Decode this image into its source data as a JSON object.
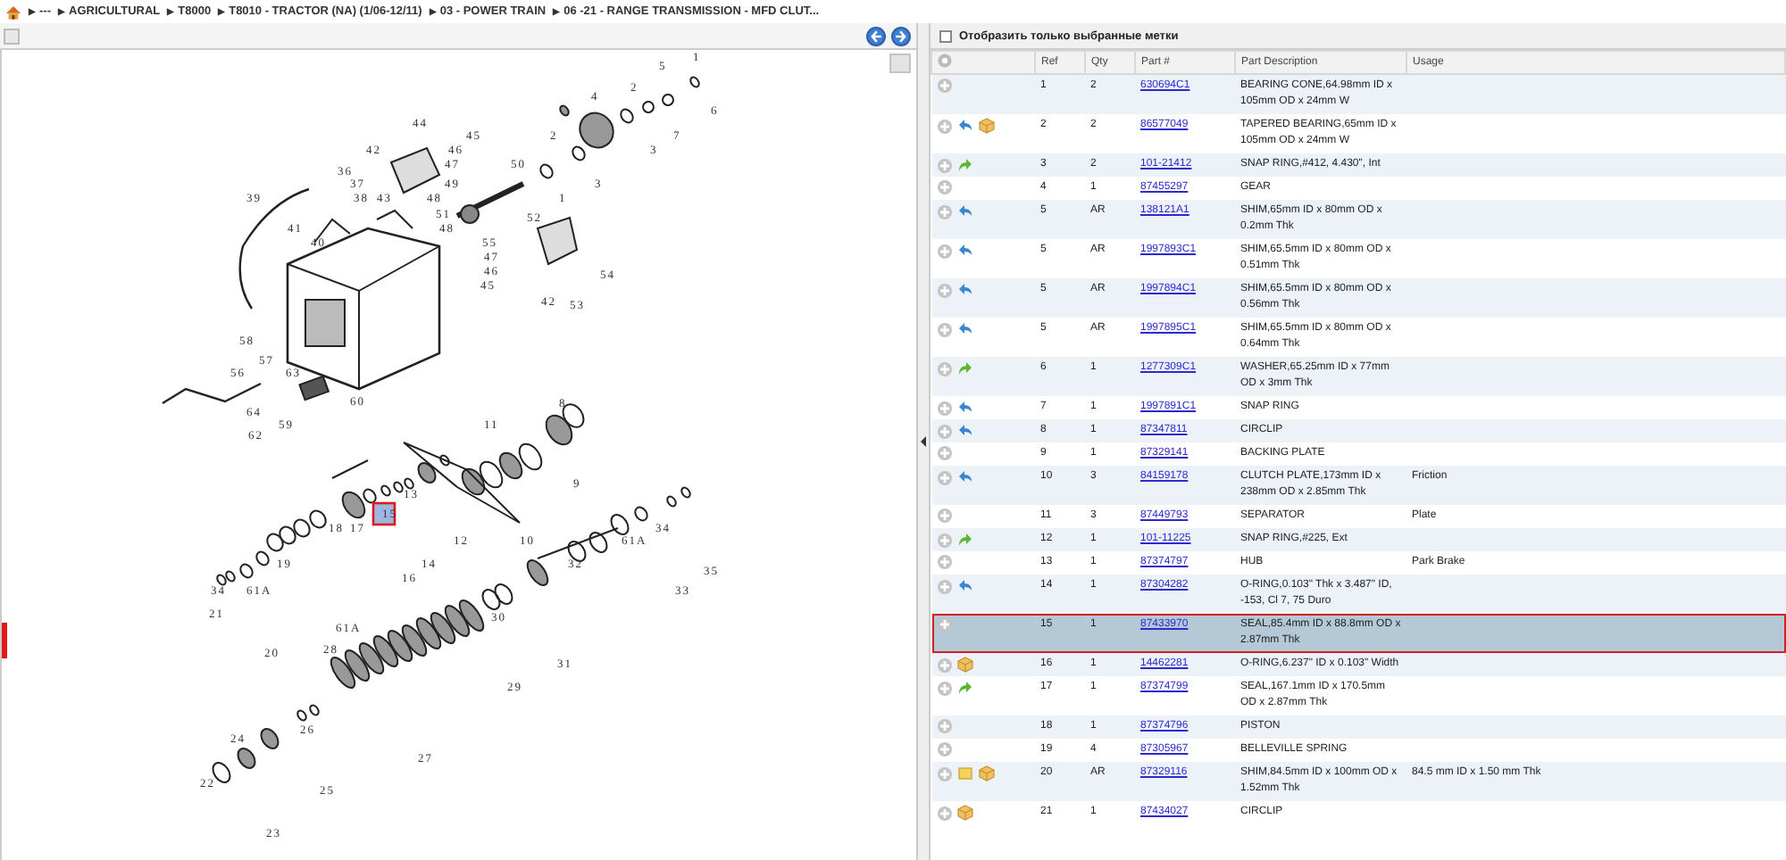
{
  "breadcrumb": {
    "separator": "▶",
    "items": [
      "---",
      "AGRICULTURAL",
      "T8000",
      "T8010 - TRACTOR (NA) (1/06-12/11)",
      "03 - POWER TRAIN",
      "06 -21 - RANGE TRANSMISSION - MFD CLUT..."
    ]
  },
  "diagram": {
    "callouts": [
      {
        "label": "1",
        "selected": false
      },
      {
        "label": "5",
        "selected": false
      },
      {
        "label": "2",
        "selected": false
      },
      {
        "label": "4",
        "selected": false
      },
      {
        "label": "6",
        "selected": false
      },
      {
        "label": "44",
        "selected": false
      },
      {
        "label": "45",
        "selected": false
      },
      {
        "label": "2",
        "selected": false
      },
      {
        "label": "7",
        "selected": false
      },
      {
        "label": "42",
        "selected": false
      },
      {
        "label": "46",
        "selected": false
      },
      {
        "label": "3",
        "selected": false
      },
      {
        "label": "47",
        "selected": false
      },
      {
        "label": "50",
        "selected": false
      },
      {
        "label": "36",
        "selected": false
      },
      {
        "label": "37",
        "selected": false
      },
      {
        "label": "49",
        "selected": false
      },
      {
        "label": "3",
        "selected": false
      },
      {
        "label": "39",
        "selected": false
      },
      {
        "label": "38",
        "selected": false
      },
      {
        "label": "43",
        "selected": false
      },
      {
        "label": "48",
        "selected": false
      },
      {
        "label": "1",
        "selected": false
      },
      {
        "label": "51",
        "selected": false
      },
      {
        "label": "52",
        "selected": false
      },
      {
        "label": "41",
        "selected": false
      },
      {
        "label": "48",
        "selected": false
      },
      {
        "label": "40",
        "selected": false
      },
      {
        "label": "55",
        "selected": false
      },
      {
        "label": "47",
        "selected": false
      },
      {
        "label": "46",
        "selected": false
      },
      {
        "label": "54",
        "selected": false
      },
      {
        "label": "45",
        "selected": false
      },
      {
        "label": "42",
        "selected": false
      },
      {
        "label": "53",
        "selected": false
      },
      {
        "label": "58",
        "selected": false
      },
      {
        "label": "57",
        "selected": false
      },
      {
        "label": "56",
        "selected": false
      },
      {
        "label": "63",
        "selected": false
      },
      {
        "label": "60",
        "selected": false
      },
      {
        "label": "8",
        "selected": false
      },
      {
        "label": "64",
        "selected": false
      },
      {
        "label": "59",
        "selected": false
      },
      {
        "label": "11",
        "selected": false
      },
      {
        "label": "62",
        "selected": false
      },
      {
        "label": "9",
        "selected": false
      },
      {
        "label": "13",
        "selected": false
      },
      {
        "label": "15",
        "selected": true
      },
      {
        "label": "18",
        "selected": false
      },
      {
        "label": "17",
        "selected": false
      },
      {
        "label": "34",
        "selected": false
      },
      {
        "label": "12",
        "selected": false
      },
      {
        "label": "10",
        "selected": false
      },
      {
        "label": "61A",
        "selected": false
      },
      {
        "label": "19",
        "selected": false
      },
      {
        "label": "14",
        "selected": false
      },
      {
        "label": "32",
        "selected": false
      },
      {
        "label": "35",
        "selected": false
      },
      {
        "label": "16",
        "selected": false
      },
      {
        "label": "34",
        "selected": false
      },
      {
        "label": "61A",
        "selected": false
      },
      {
        "label": "33",
        "selected": false
      },
      {
        "label": "21",
        "selected": false
      },
      {
        "label": "30",
        "selected": false
      },
      {
        "label": "61A",
        "selected": false
      },
      {
        "label": "20",
        "selected": false
      },
      {
        "label": "31",
        "selected": false
      },
      {
        "label": "28",
        "selected": false
      },
      {
        "label": "29",
        "selected": false
      },
      {
        "label": "26",
        "selected": false
      },
      {
        "label": "24",
        "selected": false
      },
      {
        "label": "27",
        "selected": false
      },
      {
        "label": "22",
        "selected": false
      },
      {
        "label": "25",
        "selected": false
      },
      {
        "label": "23",
        "selected": false
      }
    ]
  },
  "filter": {
    "label": "Отобразить только выбранные метки",
    "checked": false
  },
  "table": {
    "columns": [
      "Ref",
      "Qty",
      "Part #",
      "Part Description",
      "Usage"
    ],
    "rows": [
      {
        "icons": [],
        "ref": "1",
        "qty": "2",
        "part": "630694C1",
        "description": "BEARING CONE,64.98mm ID x 105mm OD x 24mm W",
        "selected": false
      },
      {
        "icons": [
          {
            "kind": "reverse"
          },
          {
            "kind": "box"
          }
        ],
        "ref": "2",
        "qty": "2",
        "part": "86577049",
        "description": "TAPERED BEARING,65mm ID x 105mm OD x 24mm W",
        "selected": false
      },
      {
        "icons": [
          {
            "kind": "forward"
          }
        ],
        "ref": "3",
        "qty": "2",
        "part": "101-21412",
        "description": "SNAP RING,#412, 4.430\", Int",
        "selected": false
      },
      {
        "icons": [],
        "ref": "4",
        "qty": "1",
        "part": "87455297",
        "description": "GEAR",
        "selected": false
      },
      {
        "icons": [
          {
            "kind": "reverse"
          }
        ],
        "ref": "5",
        "qty": "AR",
        "part": "138121A1",
        "description": "SHIM,65mm ID x 80mm OD x 0.2mm Thk",
        "selected": false
      },
      {
        "icons": [
          {
            "kind": "reverse"
          }
        ],
        "ref": "5",
        "qty": "AR",
        "part": "1997893C1",
        "description": "SHIM,65.5mm ID x 80mm OD x 0.51mm Thk",
        "selected": false
      },
      {
        "icons": [
          {
            "kind": "reverse"
          }
        ],
        "ref": "5",
        "qty": "AR",
        "part": "1997894C1",
        "description": "SHIM,65.5mm ID x 80mm OD x 0.56mm Thk",
        "selected": false
      },
      {
        "icons": [
          {
            "kind": "reverse"
          }
        ],
        "ref": "5",
        "qty": "AR",
        "part": "1997895C1",
        "description": "SHIM,65.5mm ID x 80mm OD x 0.64mm Thk",
        "selected": false
      },
      {
        "icons": [
          {
            "kind": "forward"
          }
        ],
        "ref": "6",
        "qty": "1",
        "part": "1277309C1",
        "description": "WASHER,65.25mm ID x 77mm OD x 3mm Thk",
        "selected": false
      },
      {
        "icons": [
          {
            "kind": "reverse"
          }
        ],
        "ref": "7",
        "qty": "1",
        "part": "1997891C1",
        "description": "SNAP RING",
        "selected": false
      },
      {
        "icons": [
          {
            "kind": "reverse"
          }
        ],
        "ref": "8",
        "qty": "1",
        "part": "87347811",
        "description": "CIRCLIP",
        "selected": false
      },
      {
        "icons": [],
        "ref": "9",
        "qty": "1",
        "part": "87329141",
        "description": "BACKING PLATE",
        "selected": false
      },
      {
        "icons": [
          {
            "kind": "reverse"
          }
        ],
        "ref": "10",
        "qty": "3",
        "part": "84159178",
        "description": "CLUTCH PLATE,173mm ID x 238mm OD x 2.85mm Thk",
        "usage": "Friction",
        "selected": false
      },
      {
        "icons": [],
        "ref": "11",
        "qty": "3",
        "part": "87449793",
        "description": "SEPARATOR",
        "usage": "Plate",
        "selected": false
      },
      {
        "icons": [
          {
            "kind": "forward"
          }
        ],
        "ref": "12",
        "qty": "1",
        "part": "101-11225",
        "description": "SNAP RING,#225, Ext",
        "selected": false
      },
      {
        "icons": [],
        "ref": "13",
        "qty": "1",
        "part": "87374797",
        "description": "HUB",
        "usage": "Park Brake",
        "selected": false
      },
      {
        "icons": [
          {
            "kind": "reverse"
          }
        ],
        "ref": "14",
        "qty": "1",
        "part": "87304282",
        "description": "O-RING,0.103\" Thk x 3.487\" ID, -153, Cl 7, 75 Duro",
        "selected": false
      },
      {
        "icons": [],
        "ref": "15",
        "qty": "1",
        "part": "87433970",
        "description": "SEAL,85.4mm ID x 88.8mm OD x 2.87mm Thk",
        "selected": true
      },
      {
        "icons": [
          {
            "kind": "box"
          }
        ],
        "ref": "16",
        "qty": "1",
        "part": "14462281",
        "description": "O-RING,6.237\" ID x 0.103\" Width",
        "selected": false
      },
      {
        "icons": [
          {
            "kind": "forward"
          }
        ],
        "ref": "17",
        "qty": "1",
        "part": "87374799",
        "description": "SEAL,167.1mm ID x 170.5mm OD x 2.87mm Thk",
        "selected": false
      },
      {
        "icons": [],
        "ref": "18",
        "qty": "1",
        "part": "87374796",
        "description": "PISTON",
        "selected": false
      },
      {
        "icons": [],
        "ref": "19",
        "qty": "4",
        "part": "87305967",
        "description": "BELLEVILLE SPRING",
        "selected": false
      },
      {
        "icons": [
          {
            "kind": "note"
          },
          {
            "kind": "box"
          }
        ],
        "ref": "20",
        "qty": "AR",
        "part": "87329116",
        "description": "SHIM,84.5mm ID x 100mm OD x 1.52mm Thk",
        "usage": "84.5 mm ID x 1.50 mm Thk",
        "selected": false
      },
      {
        "icons": [
          {
            "kind": "box"
          }
        ],
        "ref": "21",
        "qty": "1",
        "part": "87434027",
        "description": "CIRCLIP",
        "selected": false
      }
    ]
  }
}
